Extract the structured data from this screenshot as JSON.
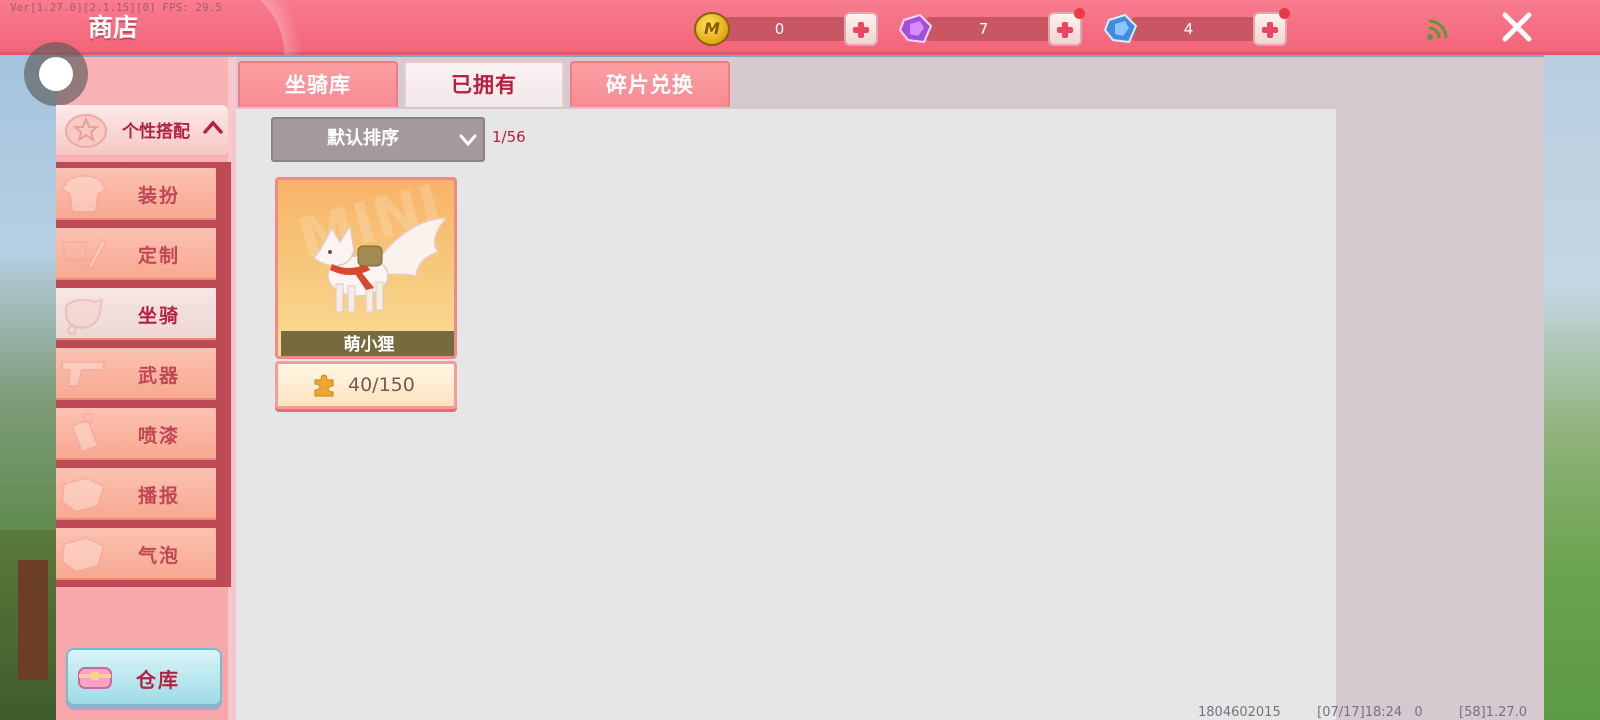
{
  "version_overlay": "Ver[1.27.0][2.1.15][0] FPS: 29.5",
  "shop_title": "商店",
  "currencies": [
    {
      "name": "coin-currency",
      "value": "0"
    },
    {
      "name": "purple-gem-currency",
      "value": "7"
    },
    {
      "name": "blue-gem-currency",
      "value": "4"
    }
  ],
  "coin_icon_letter": "M",
  "category_header": {
    "label": "个性搭配"
  },
  "nav_items": [
    {
      "label": "装扮"
    },
    {
      "label": "定制"
    },
    {
      "label": "坐骑",
      "active": true
    },
    {
      "label": "武器"
    },
    {
      "label": "喷漆"
    },
    {
      "label": "播报"
    },
    {
      "label": "气泡"
    }
  ],
  "warehouse_label": "仓库",
  "tabs": [
    {
      "label": "坐骑库"
    },
    {
      "label": "已拥有",
      "active": true
    },
    {
      "label": "碎片兑换"
    }
  ],
  "sort_dropdown": {
    "label": "默认排序"
  },
  "item_counter": "1/56",
  "card": {
    "watermark": "MINI",
    "name": "萌小狸",
    "progress": "40/150"
  },
  "footer": {
    "id": "1804602015",
    "datetime": "[07/17]18:24 0",
    "version": "[58]1.27.0"
  },
  "colors": {
    "topbar": "#f36479",
    "accent_text": "#b5223f",
    "nav_bg": "#f7a891",
    "content_bg": "#e6e6e6"
  }
}
